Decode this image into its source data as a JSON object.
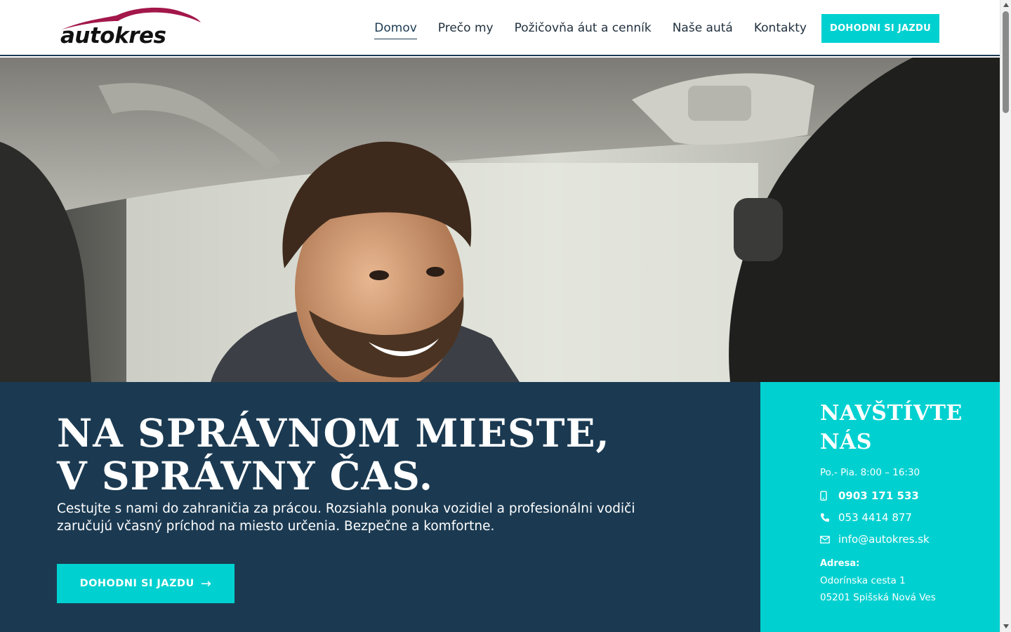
{
  "header": {
    "logo_text": "autokres",
    "nav": [
      {
        "label": "Domov",
        "active": true
      },
      {
        "label": "Prečo my"
      },
      {
        "label": "Požičovňa áut a cenník"
      },
      {
        "label": "Naše autá"
      },
      {
        "label": "Kontakty"
      }
    ],
    "cta_label": "DOHODNI SI JAZDU"
  },
  "hero": {
    "image": "smiling-bearded-driver-in-car"
  },
  "main": {
    "headline_line1": "NA SPRÁVNOM MIESTE,",
    "headline_line2": "V SPRÁVNY ČAS.",
    "lead": "Cestujte s nami do zahraničia za prácou. Rozsiahla ponuka vozidiel a profesionálni vodiči zaručujú včasný príchod na miesto určenia. Bezpečne a komfortne.",
    "cta_label": "DOHODNI SI JAZDU",
    "cta_icon": "arrow-right-icon"
  },
  "contact": {
    "title_line1": "NAVŠTÍVTE",
    "title_line2": "NÁS",
    "hours": "Po.- Pia. 8:00 – 16:30",
    "mobile": "0903 171 533",
    "phone": "053 4414 877",
    "email": "info@autokres.sk",
    "address_label": "Adresa:",
    "address_line1": "Odorínska cesta 1",
    "address_line2": "05201 Spišská Nová Ves"
  },
  "colors": {
    "accent": "#00d1d0",
    "dark": "#1b3a52",
    "logo_swoosh": "#a3174a"
  }
}
